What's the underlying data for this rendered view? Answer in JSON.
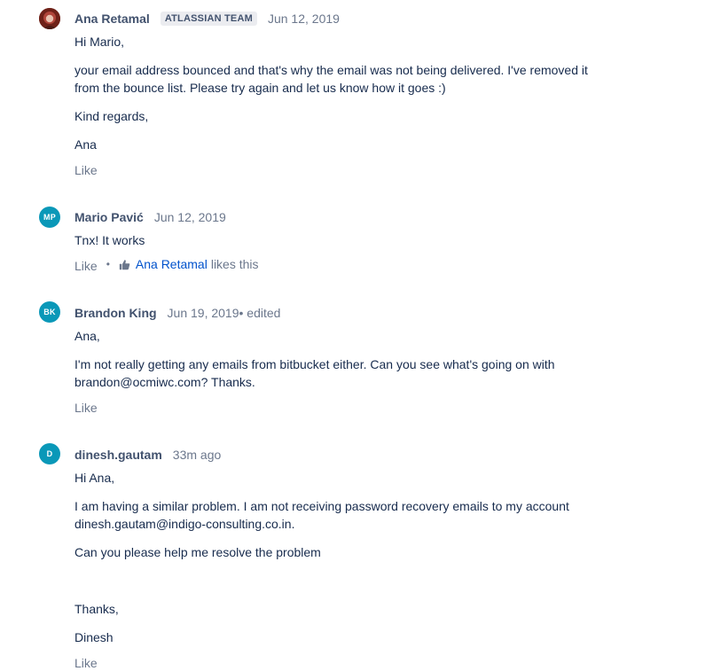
{
  "comments": [
    {
      "author": "Ana Retamal",
      "badge": "ATLASSIAN TEAM",
      "date": "Jun 12, 2019",
      "paragraphs": [
        "Hi Mario,",
        "your email address bounced and that's why the email was not being delivered. I've removed it from the bounce list. Please try again and let us know how it goes :)",
        "Kind regards,",
        "Ana"
      ],
      "like_label": "Like"
    },
    {
      "author": "Mario Pavić",
      "initials": "MP",
      "date": "Jun 12, 2019",
      "paragraphs": [
        "Tnx! It works"
      ],
      "like_label": "Like",
      "liked_by": "Ana Retamal",
      "likes_suffix": "likes this"
    },
    {
      "author": "Brandon King",
      "initials": "BK",
      "date": "Jun 19, 2019",
      "edited": " • edited",
      "paragraphs": [
        "Ana,",
        "I'm not really getting any emails from bitbucket either. Can you see what's going on with brandon@ocmiwc.com? Thanks."
      ],
      "like_label": "Like"
    },
    {
      "author": "dinesh.gautam",
      "initials": "D",
      "date": "33m ago",
      "paragraphs": [
        "Hi Ana,",
        "I am having a similar problem. I am not receiving password recovery emails to my account dinesh.gautam@indigo-consulting.co.in.",
        "Can you please help me resolve the problem",
        "Thanks,",
        "Dinesh"
      ],
      "like_label": "Like"
    }
  ],
  "colors": {
    "avatar_bg": "#0a98b8",
    "link": "#0052cc",
    "muted": "#6b778c",
    "author": "#42526e"
  }
}
